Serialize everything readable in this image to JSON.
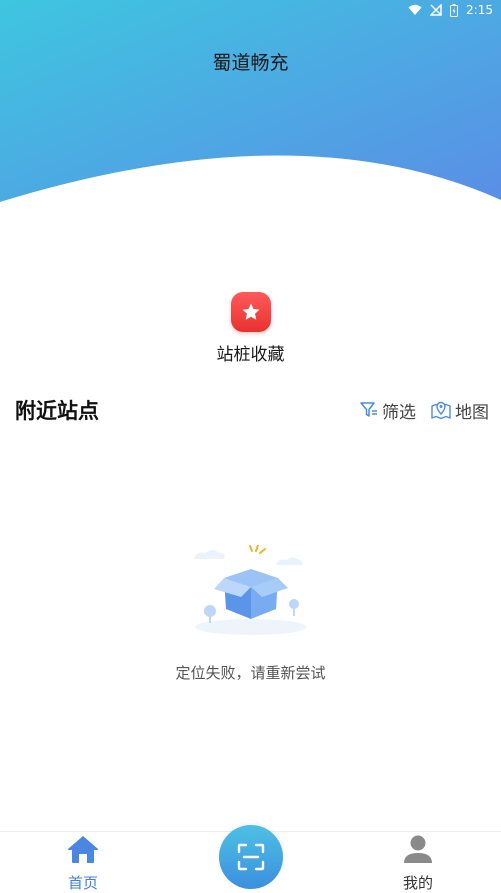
{
  "status_bar": {
    "time": "2:15"
  },
  "header": {
    "title": "蜀道畅充"
  },
  "favorites": {
    "label": "站桩收藏",
    "icon": "star-icon"
  },
  "nearby": {
    "title": "附近站点",
    "filter_label": "筛选",
    "map_label": "地图"
  },
  "empty_state": {
    "message": "定位失败，请重新尝试",
    "illustration": "empty-box-illustration"
  },
  "bottom_nav": {
    "home_label": "首页",
    "mine_label": "我的",
    "scan_icon": "scan-icon"
  },
  "colors": {
    "header_gradient_start": "#3ec6e0",
    "header_gradient_end": "#5a8ee6",
    "accent": "#3d7fe0",
    "favorite_red": "#e8312f"
  }
}
